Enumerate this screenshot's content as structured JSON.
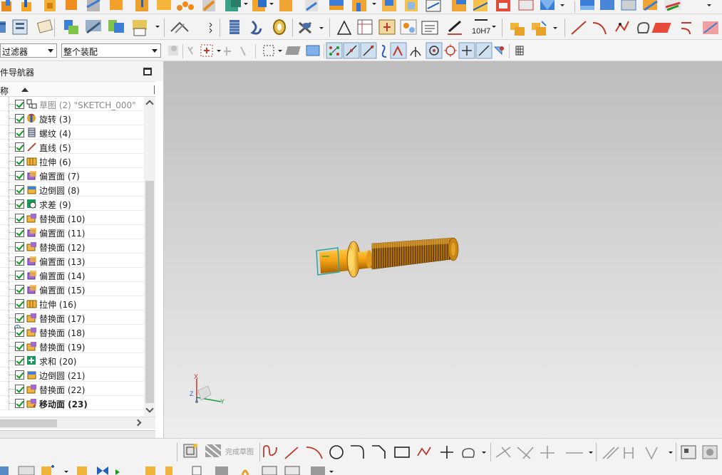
{
  "filter_bar": {
    "type_filter_value": "过滤器",
    "assembly_scope_value": "整个装配"
  },
  "navigator": {
    "title": "件导航器",
    "column_name": "称",
    "features": [
      {
        "label": "草图 (2) \"SKETCH_000\"",
        "icon": "sketch-icon",
        "state": "dim"
      },
      {
        "label": "旋转 (3)",
        "icon": "revolve-icon",
        "state": "normal"
      },
      {
        "label": "螺纹 (4)",
        "icon": "thread-icon",
        "state": "normal"
      },
      {
        "label": "直线 (5)",
        "icon": "line-icon",
        "state": "normal"
      },
      {
        "label": "拉伸 (6)",
        "icon": "extrude-icon",
        "state": "normal"
      },
      {
        "label": "偏置面 (7)",
        "icon": "offset-face-icon",
        "state": "normal"
      },
      {
        "label": "边倒圆 (8)",
        "icon": "edge-blend-icon",
        "state": "normal"
      },
      {
        "label": "求差 (9)",
        "icon": "subtract-icon",
        "state": "normal"
      },
      {
        "label": "替换面 (10)",
        "icon": "replace-face-icon",
        "state": "normal"
      },
      {
        "label": "偏置面 (11)",
        "icon": "offset-face-icon",
        "state": "normal"
      },
      {
        "label": "替换面 (12)",
        "icon": "replace-face-icon",
        "state": "normal"
      },
      {
        "label": "偏置面 (13)",
        "icon": "offset-face-icon",
        "state": "normal"
      },
      {
        "label": "偏置面 (14)",
        "icon": "offset-face-icon",
        "state": "normal"
      },
      {
        "label": "偏置面 (15)",
        "icon": "offset-face-icon",
        "state": "normal"
      },
      {
        "label": "拉伸 (16)",
        "icon": "extrude-icon",
        "state": "normal"
      },
      {
        "label": "替换面 (17)",
        "icon": "replace-face-icon",
        "state": "normal"
      },
      {
        "label": "替换面 (18)",
        "icon": "replace-face-icon",
        "state": "info"
      },
      {
        "label": "替换面 (19)",
        "icon": "replace-face-icon",
        "state": "normal"
      },
      {
        "label": "求和 (20)",
        "icon": "unite-icon",
        "state": "normal"
      },
      {
        "label": "边倒圆 (21)",
        "icon": "edge-blend-icon",
        "state": "normal"
      },
      {
        "label": "替换面 (22)",
        "icon": "replace-face-icon",
        "state": "normal"
      },
      {
        "label": "移动面 (23)",
        "icon": "move-face-icon",
        "state": "bold"
      }
    ]
  },
  "triad": {
    "x_label": "X",
    "y_label": "Y",
    "z_label": "Z"
  },
  "toolbar": {
    "tolerance_label": "10H7",
    "finish_sketch_label": "完成草图"
  },
  "colors": {
    "part_orange": "#f0a010",
    "part_dark": "#a86400",
    "sketch_teal": "#2aa7a0",
    "check_green": "#0a9a1a"
  }
}
